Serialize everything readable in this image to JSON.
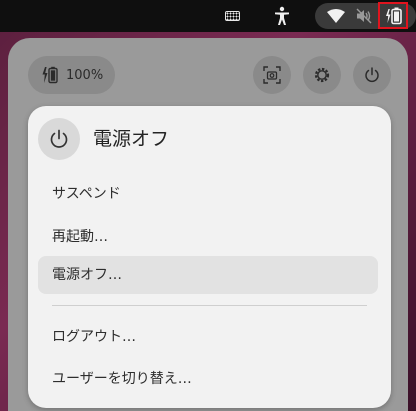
{
  "topbar": {
    "icons": {
      "keyboard": "keyboard-icon",
      "accessibility": "accessibility-icon",
      "wifi": "wifi-icon",
      "volume": "volume-muted-icon",
      "battery": "battery-charging-icon"
    },
    "highlight_color": "#e0141e"
  },
  "quick_settings": {
    "battery_label": "100%",
    "buttons": [
      "screenshot-icon",
      "settings-icon",
      "power-icon"
    ]
  },
  "power_menu": {
    "title": "電源オフ",
    "items": [
      {
        "label": "サスペンド"
      },
      {
        "label": "再起動…"
      },
      {
        "label": "電源オフ…",
        "hovered": true
      },
      {
        "label": "ログアウト…"
      },
      {
        "label": "ユーザーを切り替え…"
      }
    ]
  }
}
